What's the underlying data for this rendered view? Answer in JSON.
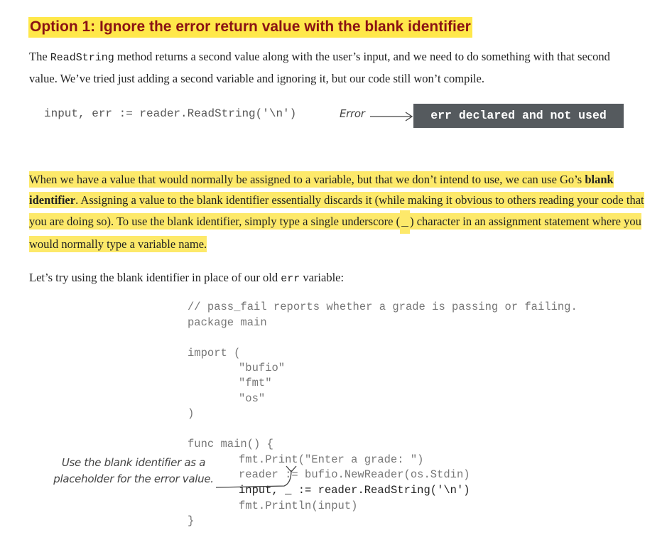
{
  "heading": "Option 1: Ignore the error return value with the blank identifier",
  "intro": {
    "part1": "The ",
    "code": "ReadString",
    "part2": " method returns a second value along with the user’s input, and we need to do something with that second value. We’ve tried just adding a second variable and ignoring it, but our code still won’t compile."
  },
  "example": {
    "code": "input, err := reader.ReadString('\\n')",
    "error_label": "Error",
    "error_message": "err declared and not used"
  },
  "blank_identifier_para": {
    "part1": "When we have a value that would normally be assigned to a variable, but that we don’t intend to use, we can use Go’s ",
    "bold": "blank identifier",
    "part2": ". Assigning a value to the blank identifier essentially discards it (while making it obvious to others reading your code that you are doing so). To use the blank identifier, simply type a single underscore (",
    "underscore": "_",
    "part3": ") character in an assignment statement where you would normally type a variable name."
  },
  "try_para": {
    "part1": "Let’s try using the blank identifier in place of our old ",
    "code": "err",
    "part2": " variable:"
  },
  "code_block": {
    "comment": "// pass_fail reports whether a grade is passing or failing.",
    "package": "package main",
    "import_open": "import (",
    "import_bufio": "\"bufio\"",
    "import_fmt": "\"fmt\"",
    "import_os": "\"os\"",
    "import_close": ")",
    "func_main": "func main() {",
    "print_line": "fmt.Print(\"Enter a grade: \")",
    "reader_line": "reader := bufio.NewReader(os.Stdin)",
    "input_var": "input, ",
    "blank": "_",
    "read_call": " := reader.ReadString('\\n')",
    "println_line": "fmt.Println(input)",
    "close_brace": "}"
  },
  "annotation": "Use the blank identifier as a placeholder for the error value."
}
